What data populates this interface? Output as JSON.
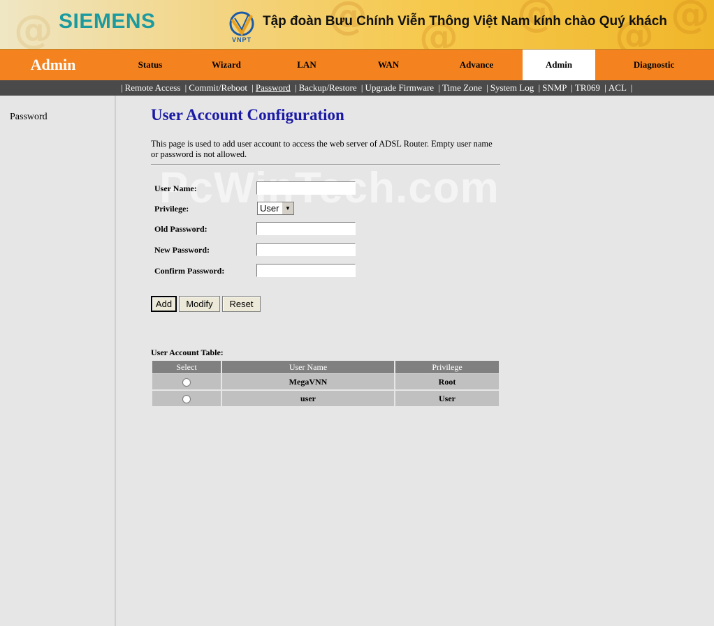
{
  "banner": {
    "brand": "SIEMENS",
    "vnpt_label": "VNPT",
    "greeting": "Tập đoàn Bưu Chính Viễn Thông Việt Nam kính chào Quý khách"
  },
  "nav": {
    "section_title": "Admin",
    "tabs": [
      "Status",
      "Wizard",
      "LAN",
      "WAN",
      "Advance",
      "Admin",
      "Diagnostic"
    ],
    "active_tab": "Admin"
  },
  "subnav": {
    "items": [
      "Remote Access",
      "Commit/Reboot",
      "Password",
      "Backup/Restore",
      "Upgrade Firmware",
      "Time Zone",
      "System Log",
      "SNMP",
      "TR069",
      "ACL"
    ],
    "current": "Password"
  },
  "sidebar": {
    "items": [
      "Password"
    ]
  },
  "main": {
    "title": "User Account Configuration",
    "description": "This page is used to add user account to access the web server of ADSL Router. Empty user name or password is not allowed.",
    "watermark": "PcWinTech.com",
    "form": {
      "user_name_label": "User Name:",
      "user_name_value": "",
      "privilege_label": "Privilege:",
      "privilege_value": "User",
      "old_password_label": "Old Password:",
      "new_password_label": "New Password:",
      "confirm_password_label": "Confirm Password:"
    },
    "buttons": {
      "add": "Add",
      "modify": "Modify",
      "reset": "Reset"
    },
    "table": {
      "label": "User Account Table:",
      "headers": [
        "Select",
        "User Name",
        "Privilege"
      ],
      "rows": [
        {
          "user_name": "MegaVNN",
          "privilege": "Root"
        },
        {
          "user_name": "user",
          "privilege": "User"
        }
      ]
    }
  },
  "colors": {
    "nav_orange": "#f4831f",
    "subnav_gray": "#4a4a4a",
    "title_blue": "#1a1aa6",
    "siemens_teal": "#1b9aa0"
  }
}
